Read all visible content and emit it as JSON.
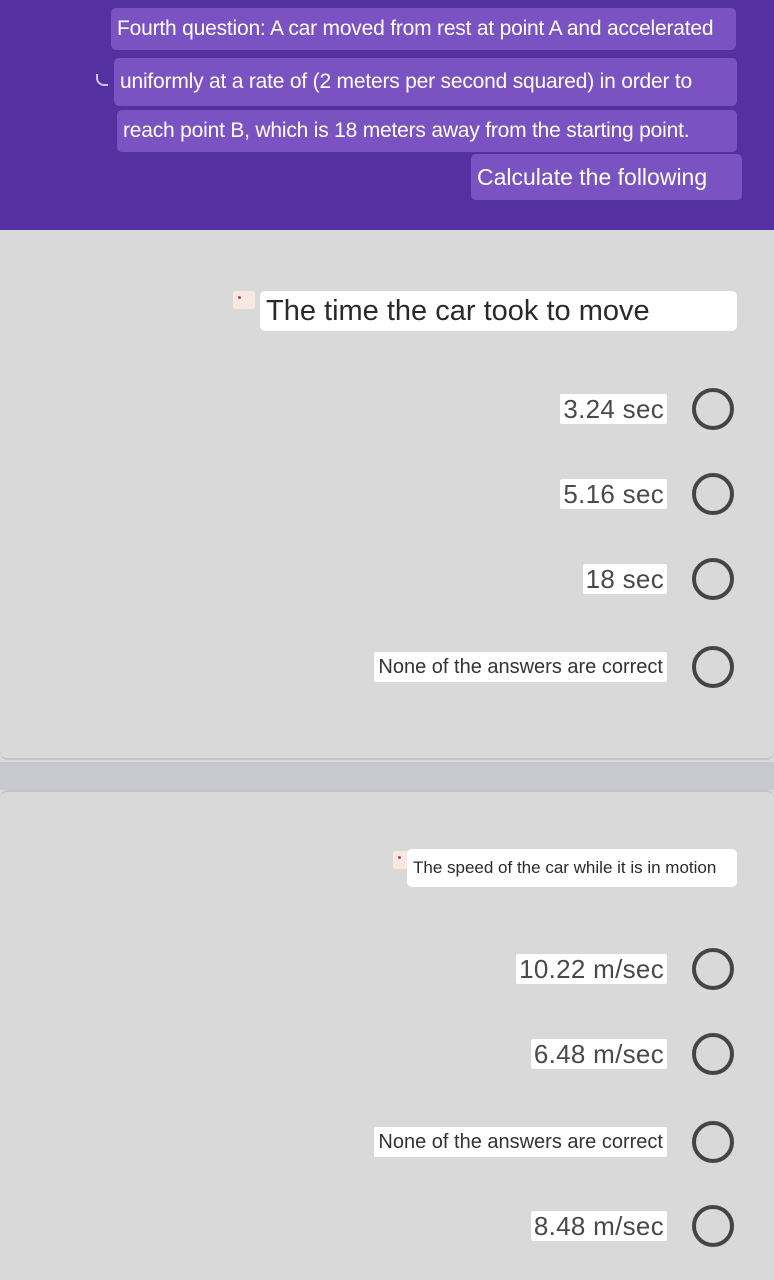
{
  "header": {
    "lines": [
      "Fourth question: A car moved from rest at point A and accelerated",
      "uniformly at a rate of (2 meters per second squared) in order to",
      "reach point B, which is 18 meters away from the starting point.",
      "Calculate the following"
    ],
    "background_color": "#5530a0",
    "highlight_color": "#7b52c2"
  },
  "questions": [
    {
      "text": "The time the car took to move",
      "required": true,
      "options": [
        {
          "label": "3.24 sec",
          "selected": false
        },
        {
          "label": "5.16 sec",
          "selected": false
        },
        {
          "label": "18 sec",
          "selected": false
        },
        {
          "label": "None of the answers are correct",
          "selected": false
        }
      ]
    },
    {
      "text": "The speed of the car while it is in motion",
      "required": true,
      "options": [
        {
          "label": "10.22 m/sec",
          "selected": false
        },
        {
          "label": "6.48 m/sec",
          "selected": false
        },
        {
          "label": "None of the answers are correct",
          "selected": false
        },
        {
          "label": "8.48 m/sec",
          "selected": false
        }
      ]
    }
  ]
}
